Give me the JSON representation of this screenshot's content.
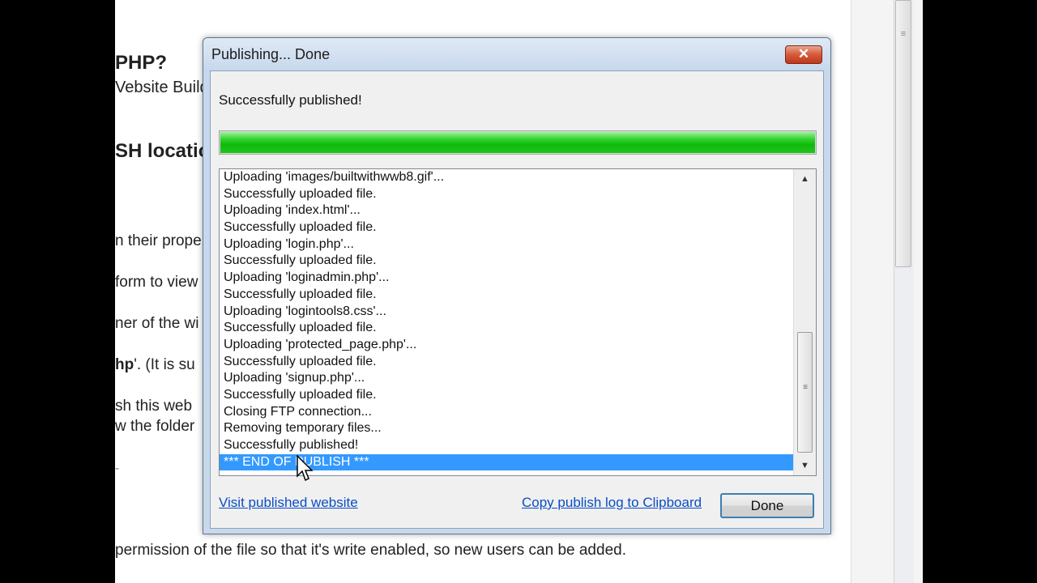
{
  "background": {
    "heading_1": "PHP?",
    "line_2": "Vebsite Build",
    "heading_3": "SH locatio",
    "line_4": "n their prope",
    "line_5": "form to view",
    "line_6": "ner of the wi",
    "line_7a": "hp",
    "line_7b": "'. (It is su",
    "line_8": "sh this web",
    "line_9": "w the folder",
    "line_10": "-",
    "bottom_line": "permission of the file so that it's write enabled, so new users can be added."
  },
  "dialog": {
    "title": "Publishing... Done",
    "close_label": "✕",
    "status": "Successfully published!",
    "progress_percent": 100,
    "log_lines": [
      "Uploading 'images/builtwithwwb8.gif'...",
      "Successfully uploaded file.",
      "Uploading 'index.html'...",
      "Successfully uploaded file.",
      "Uploading 'login.php'...",
      "Successfully uploaded file.",
      "Uploading 'loginadmin.php'...",
      "Successfully uploaded file.",
      "Uploading 'logintools8.css'...",
      "Successfully uploaded file.",
      "Uploading 'protected_page.php'...",
      "Successfully uploaded file.",
      "Uploading 'signup.php'...",
      "Successfully uploaded file.",
      "Closing FTP connection...",
      "Removing temporary files...",
      "Successfully published!",
      "*** END OF PUBLISH ***"
    ],
    "selected_line_index": 17,
    "visit_link": "Visit published website",
    "copy_link": "Copy publish log to Clipboard",
    "done_label": "Done"
  },
  "icons": {
    "close": "close-icon",
    "scroll_up": "scroll-up-arrow-icon",
    "scroll_down": "scroll-down-arrow-icon",
    "cursor": "mouse-pointer-icon"
  },
  "colors": {
    "progress": "#1ec61a",
    "selection": "#3399ff",
    "link": "#0b4ec4"
  }
}
